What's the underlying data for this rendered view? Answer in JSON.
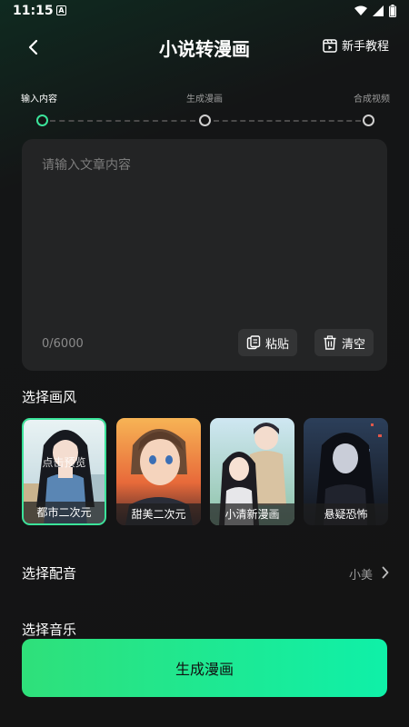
{
  "status_bar": {
    "time": "11:15",
    "notification_letter": "A"
  },
  "header": {
    "title": "小说转漫画",
    "tutorial_label": "新手教程"
  },
  "steps": [
    {
      "label": "输入内容",
      "active": true
    },
    {
      "label": "生成漫画",
      "active": false
    },
    {
      "label": "合成视频",
      "active": false
    }
  ],
  "input": {
    "placeholder": "请输入文章内容",
    "char_count": "0/6000",
    "paste_label": "粘贴",
    "clear_label": "清空"
  },
  "style_section": {
    "title": "选择画风",
    "preview_hint": "点击预览",
    "styles": [
      {
        "label": "都市二次元",
        "selected": true
      },
      {
        "label": "甜美二次元",
        "selected": false
      },
      {
        "label": "小清新漫画",
        "selected": false
      },
      {
        "label": "悬疑恐怖",
        "selected": false
      }
    ]
  },
  "voice": {
    "label": "选择配音",
    "value": "小美"
  },
  "music": {
    "label": "选择音乐"
  },
  "generate_label": "生成漫画",
  "colors": {
    "accent": "#3be39a",
    "button_start": "#2fe07a",
    "button_end": "#0ff0a8",
    "card_bg": "#232425"
  }
}
